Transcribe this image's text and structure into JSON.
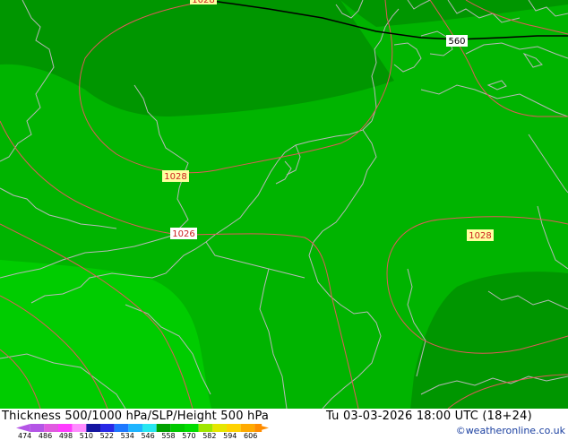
{
  "map": {
    "contour_labels": [
      "1028",
      "1028",
      "1026",
      "1028",
      "1028",
      "560"
    ]
  },
  "footer": {
    "title": "Thickness 500/1000 hPa/SLP/Height 500 hPa",
    "valid_time": "Tu 03-03-2026 18:00 UTC (18+24)",
    "credit": "©weatheronline.co.uk"
  },
  "scale": {
    "colors": [
      "#b455e6",
      "#e05ae0",
      "#ff3cff",
      "#ff8cff",
      "#1414a0",
      "#2828e6",
      "#1e78ff",
      "#1eb4ff",
      "#28e6f0",
      "#00a000",
      "#00c800",
      "#00dc00",
      "#a0e600",
      "#e6e600",
      "#ffd200",
      "#ffaa00",
      "#ff8c00"
    ],
    "labels": [
      "474",
      "486",
      "498",
      "510",
      "522",
      "534",
      "546",
      "558",
      "570",
      "582",
      "594",
      "606"
    ]
  }
}
